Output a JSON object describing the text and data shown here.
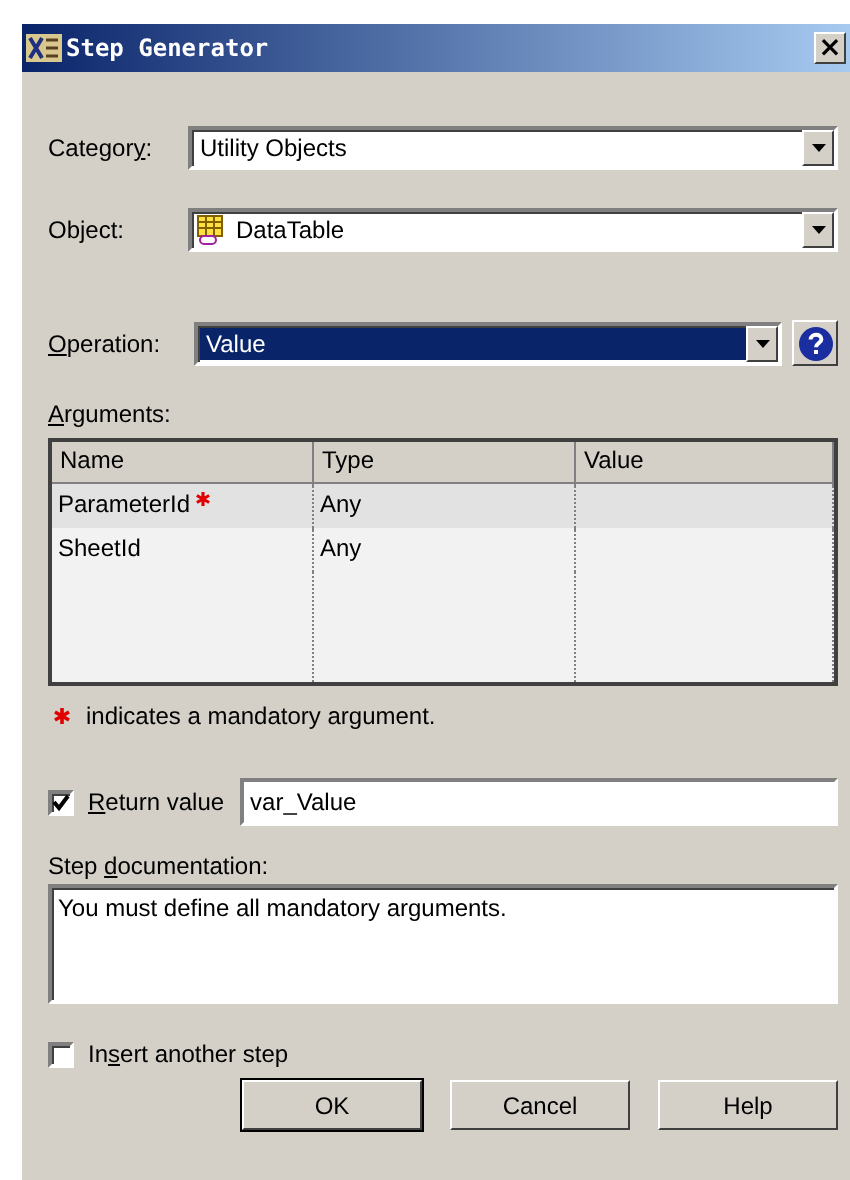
{
  "window": {
    "title": "Step Generator",
    "close": "×"
  },
  "category": {
    "label": "Category:",
    "value": "Utility Objects"
  },
  "object": {
    "label": "Object:",
    "value": "DataTable"
  },
  "operation": {
    "label": "Operation:",
    "value": "Value",
    "focused": true
  },
  "arguments": {
    "label": "Arguments:",
    "columns": [
      "Name",
      "Type",
      "Value"
    ],
    "rows": [
      {
        "name": "ParameterId",
        "mandatory": true,
        "type": "Any",
        "selected": true
      },
      {
        "name": "SheetId",
        "mandatory": false,
        "type": "Any",
        "selected": false
      }
    ],
    "note": "indicates a mandatory argument."
  },
  "return_value": {
    "label": "Return value",
    "checked": true,
    "value": "var_Value"
  },
  "documentation": {
    "label": "Step documentation:",
    "value": "You must define all mandatory arguments."
  },
  "insert_another": {
    "label": "Insert another step",
    "checked": false
  },
  "buttons": [
    "OK",
    "Cancel",
    "Help"
  ]
}
